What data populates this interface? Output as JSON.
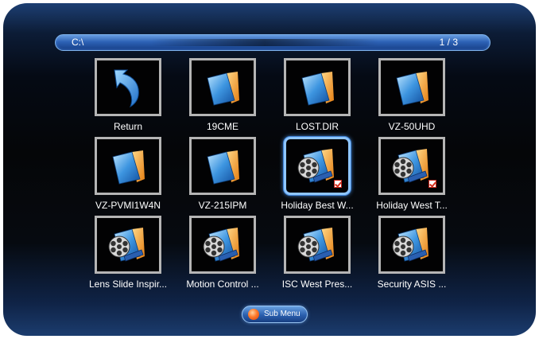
{
  "pathbar": {
    "path": "C:\\",
    "page": "1 / 3"
  },
  "items": [
    {
      "label": "Return",
      "icon": "return-arrow-icon",
      "checked": false,
      "selected": false
    },
    {
      "label": "19CME",
      "icon": "folder-icon",
      "checked": false,
      "selected": false
    },
    {
      "label": "LOST.DIR",
      "icon": "folder-icon",
      "checked": false,
      "selected": false
    },
    {
      "label": "VZ-50UHD",
      "icon": "folder-icon",
      "checked": false,
      "selected": false
    },
    {
      "label": "VZ-PVMI1W4N",
      "icon": "folder-icon",
      "checked": false,
      "selected": false
    },
    {
      "label": "VZ-215IPM",
      "icon": "folder-icon",
      "checked": false,
      "selected": false
    },
    {
      "label": "Holiday Best W...",
      "icon": "video-file-icon",
      "checked": true,
      "selected": true
    },
    {
      "label": "Holiday West T...",
      "icon": "video-file-icon",
      "checked": true,
      "selected": false
    },
    {
      "label": "Lens Slide Inspir...",
      "icon": "video-file-icon",
      "checked": false,
      "selected": false
    },
    {
      "label": "Motion Control ...",
      "icon": "video-file-icon",
      "checked": false,
      "selected": false
    },
    {
      "label": "ISC West Pres...",
      "icon": "video-file-icon",
      "checked": false,
      "selected": false
    },
    {
      "label": "Security ASIS ...",
      "icon": "video-file-icon",
      "checked": false,
      "selected": false
    }
  ],
  "submenu": {
    "label": "Sub Menu",
    "icon": "orange-circle-icon"
  },
  "colors": {
    "accent": "#2d62b6",
    "selection_border": "#8fc6ff",
    "check_red": "#d6311f",
    "folder_blue": "#2f7fcf",
    "folder_orange": "#f19a2b"
  }
}
